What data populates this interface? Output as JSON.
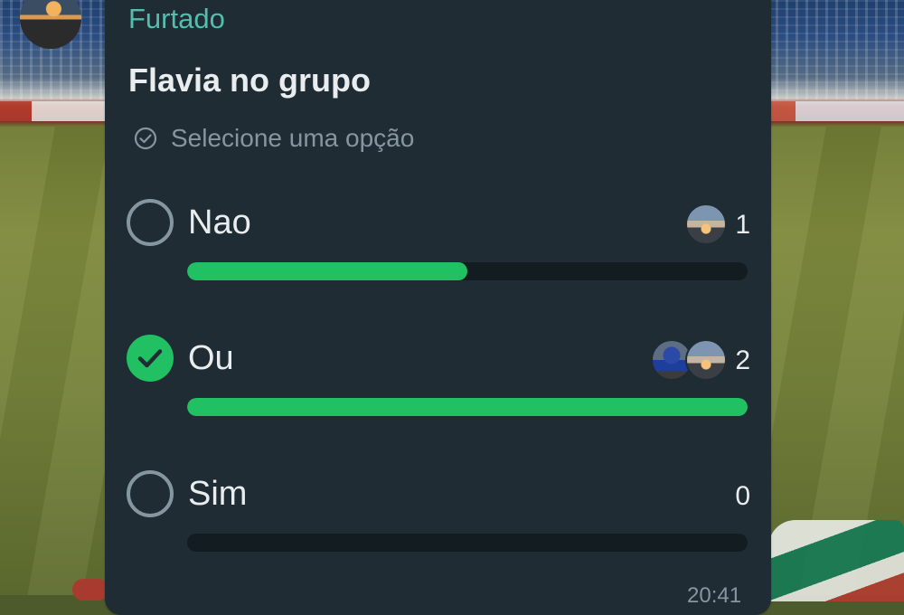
{
  "poll": {
    "sender": "Furtado",
    "question": "Flavia no grupo",
    "hint": "Selecione uma opção",
    "timestamp": "20:41",
    "options": [
      {
        "label": "Nao",
        "count": "1",
        "fraction": 0.5,
        "selected": false,
        "voters": [
          "sunset"
        ]
      },
      {
        "label": "Ou",
        "count": "2",
        "fraction": 1.0,
        "selected": true,
        "voters": [
          "person",
          "sunset"
        ]
      },
      {
        "label": "Sim",
        "count": "0",
        "fraction": 0.0,
        "selected": false,
        "voters": []
      }
    ]
  },
  "icons": {
    "hint": "check-circle-outline-icon",
    "radio_selected": "checkmark-icon"
  },
  "colors": {
    "bubble": "#1f2c33",
    "accent_green": "#21c063",
    "sender_name": "#53bdae",
    "track": "#131c21",
    "muted_text": "#8696a0",
    "primary_text": "#e9edef"
  }
}
